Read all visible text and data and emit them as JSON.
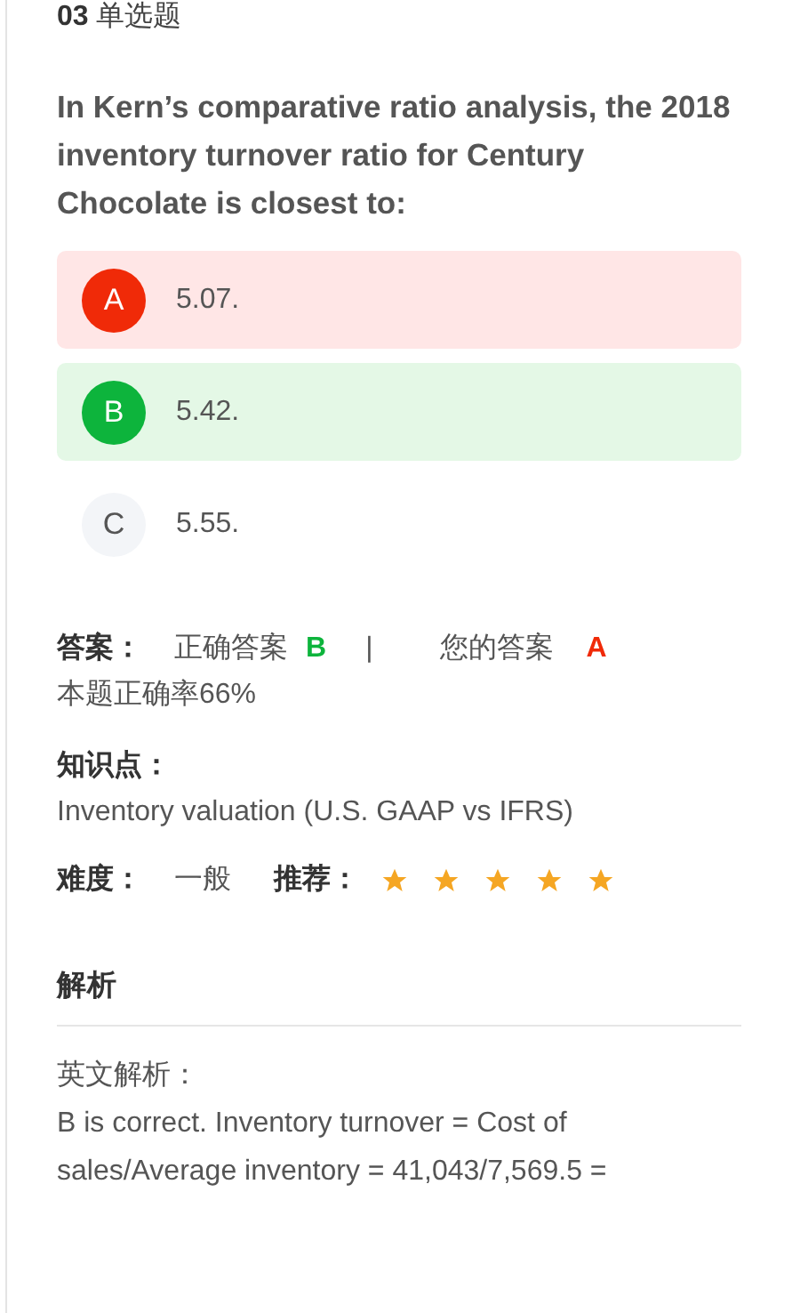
{
  "header": {
    "number": "03",
    "type": "单选题"
  },
  "question": "In Kern’s comparative ratio analysis, the 2018 inventory turnover ratio for Century Chocolate is closest to:",
  "options": [
    {
      "letter": "A",
      "text": "5.07.",
      "kind": "wrong"
    },
    {
      "letter": "B",
      "text": "5.42.",
      "kind": "correct"
    },
    {
      "letter": "C",
      "text": "5.55.",
      "kind": "plain"
    }
  ],
  "answer": {
    "label": "答案：",
    "correct_label": "正确答案",
    "correct": "B",
    "separator": "|",
    "yours_label": "您的答案",
    "yours": "A",
    "rate": "本题正确率66%"
  },
  "knowledge": {
    "label": "知识点：",
    "value": "Inventory valuation (U.S. GAAP vs IFRS)"
  },
  "difficulty": {
    "label": "难度：",
    "value": "一般"
  },
  "recommend": {
    "label": "推荐：",
    "stars": 5
  },
  "analysis": {
    "title": "解析",
    "subtitle": "英文解析：",
    "body": "B is correct. Inventory turnover = Cost of sales/Average inventory = 41,043/7,569.5 ="
  }
}
